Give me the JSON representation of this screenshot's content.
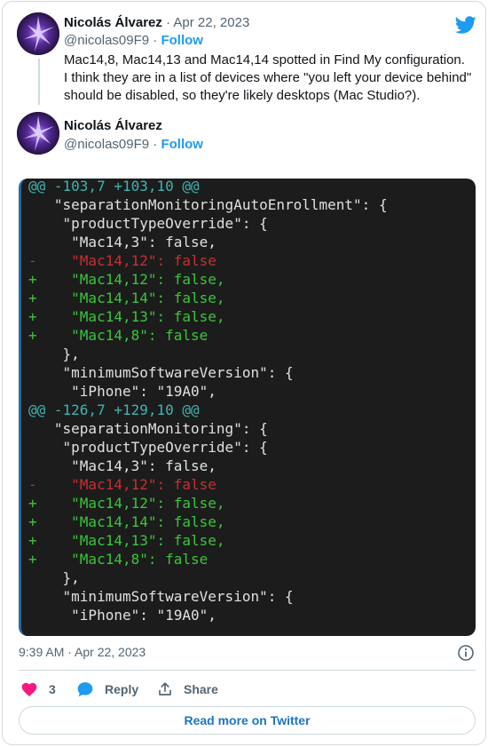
{
  "tweet1": {
    "name": "Nicolás Álvarez",
    "date": "Apr 22, 2023",
    "handle": "@nicolas09F9",
    "follow": "Follow",
    "text": "Mac14,8, Mac14,13 and Mac14,14 spotted in Find My configuration. I think they are in a list of devices where \"you left your device behind\" should be disabled, so they're likely desktops (Mac Studio?)."
  },
  "tweet2": {
    "name": "Nicolás Álvarez",
    "handle": "@nicolas09F9",
    "follow": "Follow"
  },
  "separator_dot": "·",
  "code": {
    "lines": [
      {
        "type": "hunk",
        "text": "@@ -103,7 +103,10 @@"
      },
      {
        "type": "plain",
        "text": "   \"separationMonitoringAutoEnrollment\": {"
      },
      {
        "type": "plain",
        "text": "    \"productTypeOverride\": {"
      },
      {
        "type": "plain",
        "text": "     \"Mac14,3\": false,"
      },
      {
        "type": "del",
        "text": "-    \"Mac14,12\": false"
      },
      {
        "type": "add",
        "text": "+    \"Mac14,12\": false,"
      },
      {
        "type": "add",
        "text": "+    \"Mac14,14\": false,"
      },
      {
        "type": "add",
        "text": "+    \"Mac14,13\": false,"
      },
      {
        "type": "add",
        "text": "+    \"Mac14,8\": false"
      },
      {
        "type": "plain",
        "text": "    },"
      },
      {
        "type": "plain",
        "text": "    \"minimumSoftwareVersion\": {"
      },
      {
        "type": "plain",
        "text": "     \"iPhone\": \"19A0\","
      },
      {
        "type": "hunk",
        "text": "@@ -126,7 +129,10 @@"
      },
      {
        "type": "plain",
        "text": "   \"separationMonitoring\": {"
      },
      {
        "type": "plain",
        "text": "    \"productTypeOverride\": {"
      },
      {
        "type": "plain",
        "text": "     \"Mac14,3\": false,"
      },
      {
        "type": "del",
        "text": "-    \"Mac14,12\": false"
      },
      {
        "type": "add",
        "text": "+    \"Mac14,12\": false,"
      },
      {
        "type": "add",
        "text": "+    \"Mac14,14\": false,"
      },
      {
        "type": "add",
        "text": "+    \"Mac14,13\": false,"
      },
      {
        "type": "add",
        "text": "+    \"Mac14,8\": false"
      },
      {
        "type": "plain",
        "text": "    },"
      },
      {
        "type": "plain",
        "text": "    \"minimumSoftwareVersion\": {"
      },
      {
        "type": "plain",
        "text": "     \"iPhone\": \"19A0\","
      }
    ]
  },
  "footer": {
    "timestamp": "9:39 AM · Apr 22, 2023",
    "likes": "3",
    "reply": "Reply",
    "share": "Share",
    "read_more": "Read more on Twitter"
  },
  "colors": {
    "accent": "#1d9bf0",
    "like": "#f91880",
    "muted": "#536471"
  },
  "icons": [
    "twitter-bird-icon",
    "info-icon",
    "heart-icon",
    "reply-bubble-icon",
    "share-icon"
  ]
}
